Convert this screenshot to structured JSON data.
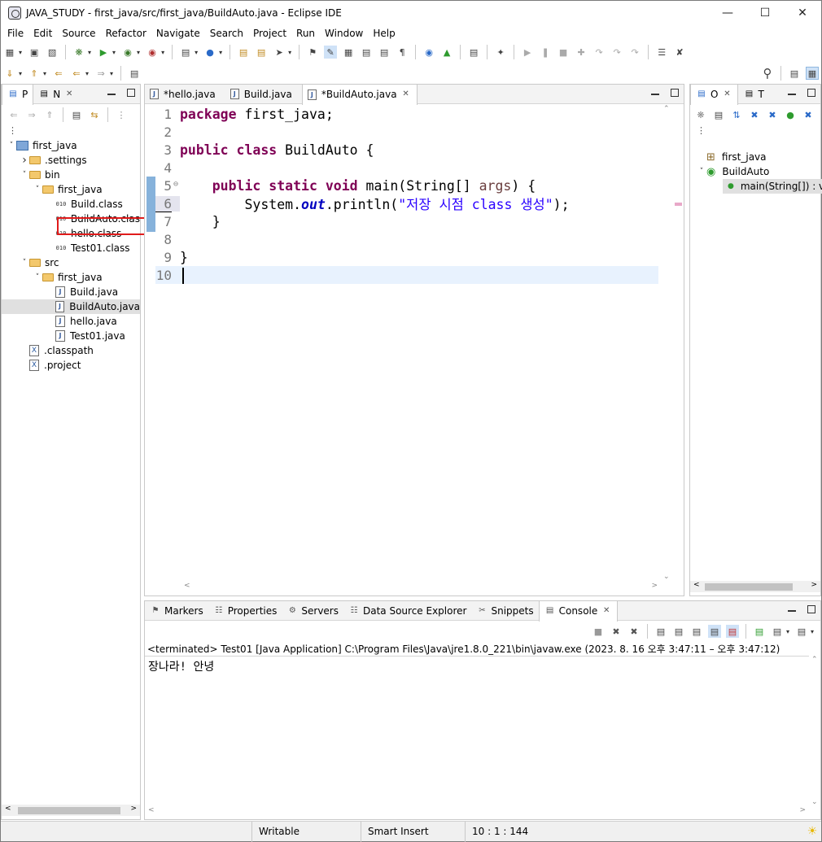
{
  "window": {
    "title": "JAVA_STUDY - first_java/src/first_java/BuildAuto.java - Eclipse IDE"
  },
  "menu": [
    "File",
    "Edit",
    "Source",
    "Refactor",
    "Navigate",
    "Search",
    "Project",
    "Run",
    "Window",
    "Help"
  ],
  "explorer": {
    "tabs": [
      {
        "label": "P"
      },
      {
        "label": "N"
      }
    ],
    "tree": [
      {
        "label": "first_java",
        "level": 0,
        "kind": "project",
        "arrow": "open"
      },
      {
        "label": ".settings",
        "level": 1,
        "kind": "folder",
        "arrow": "closed"
      },
      {
        "label": "bin",
        "level": 1,
        "kind": "folder",
        "arrow": "open"
      },
      {
        "label": "first_java",
        "level": 2,
        "kind": "folder",
        "arrow": "open"
      },
      {
        "label": "Build.class",
        "level": 3,
        "kind": "class"
      },
      {
        "label": "BuildAuto.clas",
        "level": 3,
        "kind": "class"
      },
      {
        "label": "hello.class",
        "level": 3,
        "kind": "class"
      },
      {
        "label": "Test01.class",
        "level": 3,
        "kind": "class"
      },
      {
        "label": "src",
        "level": 1,
        "kind": "folder",
        "arrow": "open"
      },
      {
        "label": "first_java",
        "level": 2,
        "kind": "folder",
        "arrow": "open"
      },
      {
        "label": "Build.java",
        "level": 3,
        "kind": "java"
      },
      {
        "label": "BuildAuto.java",
        "level": 3,
        "kind": "java",
        "selected": true
      },
      {
        "label": "hello.java",
        "level": 3,
        "kind": "java"
      },
      {
        "label": "Test01.java",
        "level": 3,
        "kind": "java"
      },
      {
        "label": ".classpath",
        "level": 1,
        "kind": "xml"
      },
      {
        "label": ".project",
        "level": 1,
        "kind": "xml"
      }
    ]
  },
  "editor": {
    "tabs": [
      {
        "label": "*hello.java"
      },
      {
        "label": "Build.java"
      },
      {
        "label": "*BuildAuto.java",
        "active": true
      }
    ],
    "lines": [
      {
        "n": "1",
        "html": "<span class='kw'>package</span> first_java;"
      },
      {
        "n": "2",
        "html": ""
      },
      {
        "n": "3",
        "html": "<span class='kw'>public</span> <span class='kw'>class</span> BuildAuto {"
      },
      {
        "n": "4",
        "html": ""
      },
      {
        "n": "5",
        "html": "    <span class='kw'>public</span> <span class='kw'>static</span> <span class='kw'>void</span> main(String[] <span class='arg'>args</span>) {"
      },
      {
        "n": "6",
        "html": "        System.<span class='fld'>out</span>.println(<span class='str'>\"저장 시점 class 생성\"</span>);"
      },
      {
        "n": "7",
        "html": "    }"
      },
      {
        "n": "8",
        "html": ""
      },
      {
        "n": "9",
        "html": "}"
      },
      {
        "n": "10",
        "html": ""
      }
    ]
  },
  "outline": {
    "tabs": [
      {
        "label": "O"
      },
      {
        "label": "T"
      }
    ],
    "items": [
      {
        "label": "first_java",
        "level": 0,
        "kind": "package"
      },
      {
        "label": "BuildAuto",
        "level": 0,
        "kind": "class",
        "arrow": "open"
      },
      {
        "label": "main(String[]) : v",
        "level": 1,
        "kind": "method",
        "selected": true
      }
    ]
  },
  "console": {
    "tabs": [
      {
        "label": "Markers"
      },
      {
        "label": "Properties"
      },
      {
        "label": "Servers"
      },
      {
        "label": "Data Source Explorer"
      },
      {
        "label": "Snippets"
      },
      {
        "label": "Console",
        "active": true
      }
    ],
    "header": "<terminated> Test01 [Java Application] C:\\Program Files\\Java\\jre1.8.0_221\\bin\\javaw.exe  (2023. 8. 16 오후 3:47:11 – 오후 3:47:12)",
    "output": "장나라! 안녕"
  },
  "status": {
    "writable": "Writable",
    "insert": "Smart Insert",
    "position": "10 : 1 : 144"
  }
}
